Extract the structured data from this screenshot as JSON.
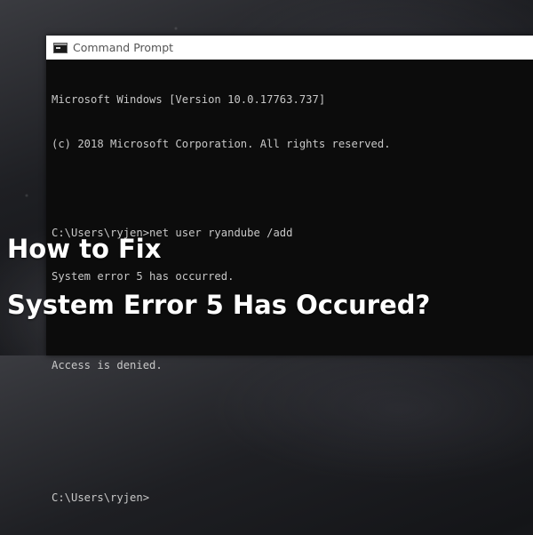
{
  "window": {
    "title": "Command Prompt",
    "icon": "command-prompt-icon"
  },
  "console": {
    "lines": [
      "Microsoft Windows [Version 10.0.17763.737]",
      "(c) 2018 Microsoft Corporation. All rights reserved.",
      "",
      "C:\\Users\\ryjen>net user ryandube /add",
      "System error 5 has occurred.",
      "",
      "Access is denied.",
      "",
      "",
      "C:\\Users\\ryjen>"
    ]
  },
  "headline": {
    "line1": "How to Fix",
    "line2": "System Error 5 Has Occured?"
  },
  "colors": {
    "console_background": "#0c0c0c",
    "console_text": "#c8c8c8",
    "titlebar": "#ffffff",
    "headline_text": "#ffffff"
  }
}
